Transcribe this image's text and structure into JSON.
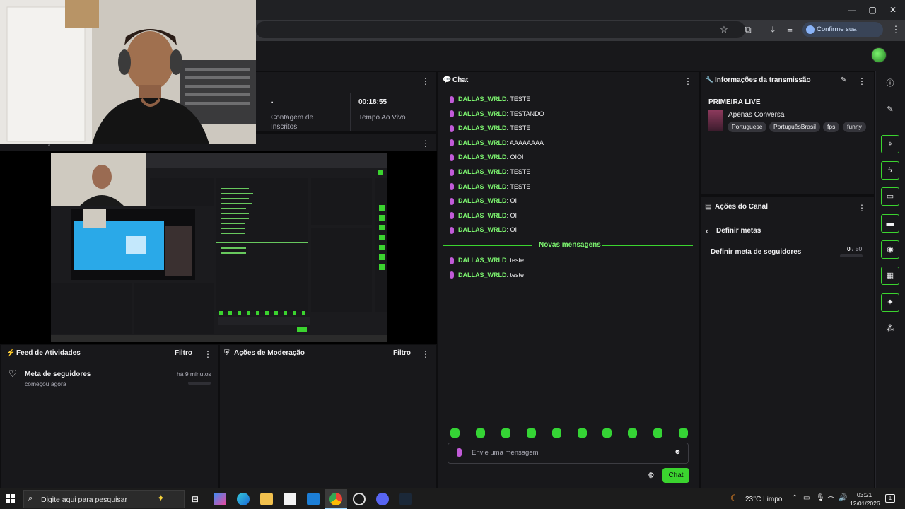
{
  "browser": {
    "window_controls": {
      "minimize": "—",
      "maximize": "▢",
      "close": "✕"
    },
    "identity_button": "Confirme sua identidade"
  },
  "stats": {
    "subs_value": "-",
    "subs_label_1": "Contagem de",
    "subs_label_2": "Inscritos",
    "time_value": "00:18:55",
    "time_label": "Tempo Ao Vivo"
  },
  "preview": {
    "title": "Visualização da Transmissão"
  },
  "activity": {
    "title": "Feed de Atividades",
    "filter": "Filtro",
    "item_title": "Meta de seguidores",
    "item_sub": "começou agora",
    "item_time": "há 9 minutos"
  },
  "moderation": {
    "title": "Ações de Moderação",
    "filter": "Filtro"
  },
  "chat": {
    "title": "Chat",
    "messages": [
      {
        "user": "DALLAS_WRLD",
        "text": ": TESTE"
      },
      {
        "user": "DALLAS_WRLD",
        "text": ": TESTANDO"
      },
      {
        "user": "DALLAS_WRLD",
        "text": ": TESTE"
      },
      {
        "user": "DALLAS_WRLD",
        "text": ": AAAAAAAA"
      },
      {
        "user": "DALLAS_WRLD",
        "text": ": OIOI"
      },
      {
        "user": "DALLAS_WRLD",
        "text": ": TESTE"
      },
      {
        "user": "DALLAS_WRLD",
        "text": ": TESTE"
      },
      {
        "user": "DALLAS_WRLD",
        "text": ": OI"
      },
      {
        "user": "DALLAS_WRLD",
        "text": ": OI"
      },
      {
        "user": "DALLAS_WRLD",
        "text": ": OI"
      }
    ],
    "divider": "Novas mensagens",
    "new_messages": [
      {
        "user": "DALLAS_WRLD",
        "text": ": teste"
      },
      {
        "user": "DALLAS_WRLD",
        "text": ": teste"
      }
    ],
    "input_placeholder": "Envie uma mensagem",
    "send_label": "Chat"
  },
  "stream_info": {
    "title": "Informações da transmissão",
    "stream_title": "PRIMEIRA LIVE",
    "category": "Apenas Conversa",
    "tags": [
      "Portuguese",
      "PortuguêsBrasil",
      "fps",
      "funny"
    ]
  },
  "channel_actions": {
    "title": "Ações do Canal",
    "back_label": "Definir metas",
    "goal_label": "Definir meta de seguidores",
    "goal_current": "0",
    "goal_total": "/ 50",
    "goal_progress": 0
  },
  "taskbar": {
    "search_placeholder": "Digite aqui para pesquisar",
    "weather": "23°C  Limpo",
    "time": "03:21",
    "date": "12/01/2026",
    "notification_count": "1"
  },
  "colors": {
    "accent": "#3bd42f",
    "username": "#7cf46f",
    "mic": "#c15bd8",
    "panel": "#18181b",
    "background": "#0e0e10"
  }
}
